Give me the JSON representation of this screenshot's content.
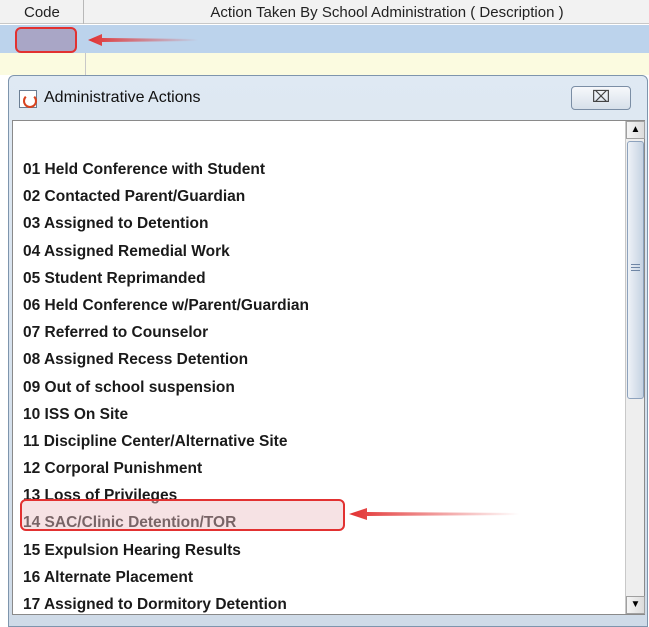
{
  "table": {
    "code_header": "Code",
    "description_header": "Action Taken By School Administration ( Description )"
  },
  "dialog": {
    "title": "Administrative Actions",
    "close_symbol": "⌧",
    "items": [
      "01 Held Conference with Student",
      "02 Contacted Parent/Guardian",
      "03 Assigned to Detention",
      "04 Assigned Remedial Work",
      "05 Student Reprimanded",
      "06 Held Conference w/Parent/Guardian",
      "07 Referred to Counselor",
      "08 Assigned Recess Detention",
      "09 Out of school suspension",
      "10 ISS On Site",
      "11 Discipline Center/Alternative Site",
      "12 Corporal Punishment",
      "13 Loss of Privileges",
      "14 SAC/Clinic Detention/TOR",
      "15 Expulsion Hearing Results",
      "16 Alternate Placement",
      "17 Assigned to Dormitory Detention"
    ],
    "highlighted_item": "12 Corporal Punishment",
    "scroll_up_symbol": "▲",
    "scroll_down_symbol": "▼"
  },
  "colors": {
    "annotation_red": "#e23131",
    "selected_row": "#bcd3ec",
    "highlight_fill": "#ebbec3"
  }
}
